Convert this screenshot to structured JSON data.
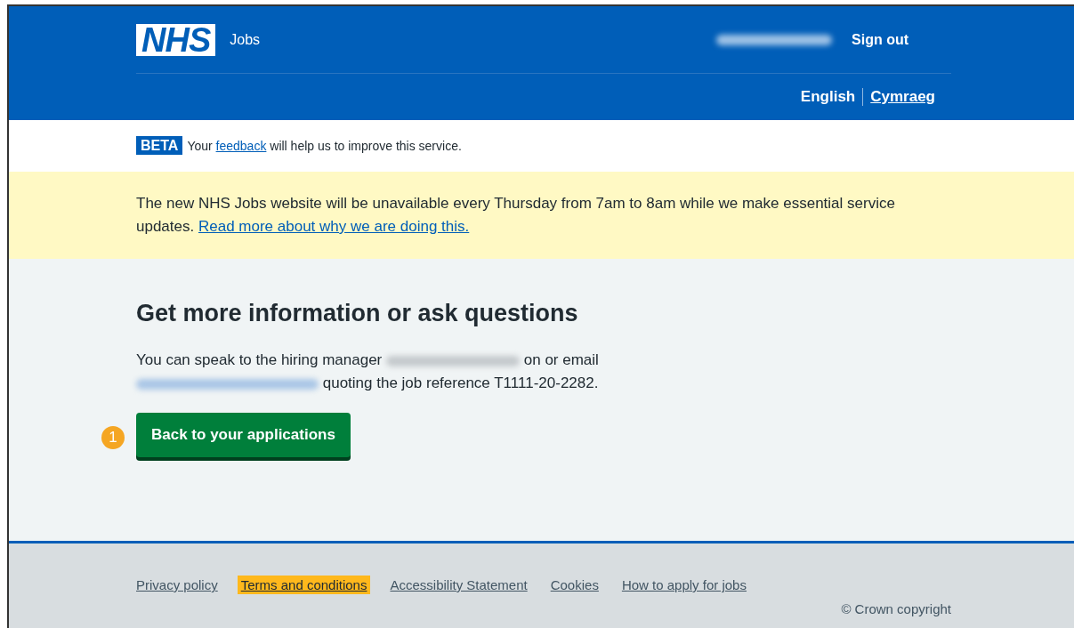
{
  "header": {
    "logo": "NHS",
    "service": "Jobs",
    "account": {
      "redacted": true
    },
    "sign_out": "Sign out",
    "languages": [
      {
        "label": "English",
        "selected": true
      },
      {
        "label": "Cymraeg",
        "selected": false
      }
    ]
  },
  "beta": {
    "tag": "BETA",
    "text_before": "Your",
    "link": "feedback",
    "text_after": "will help us to improve this service."
  },
  "notice": {
    "text": "The new NHS Jobs website will be unavailable every Thursday from 7am to 8am while we make essential service updates.",
    "link": "Read more about why we are doing this."
  },
  "main": {
    "heading": "Get more information or ask questions",
    "text_1": "You can speak to the hiring manager",
    "text_2": "on or email",
    "text_3": "quoting the job reference T1111-20-2282.",
    "button": "Back to your applications",
    "callout": "1"
  },
  "footer": {
    "links": [
      {
        "label": "Privacy policy",
        "focused": false
      },
      {
        "label": "Terms and conditions",
        "focused": true
      },
      {
        "label": "Accessibility Statement",
        "focused": false
      },
      {
        "label": "Cookies",
        "focused": false
      },
      {
        "label": "How to apply for jobs",
        "focused": false
      }
    ],
    "copyright": "© Crown copyright"
  }
}
